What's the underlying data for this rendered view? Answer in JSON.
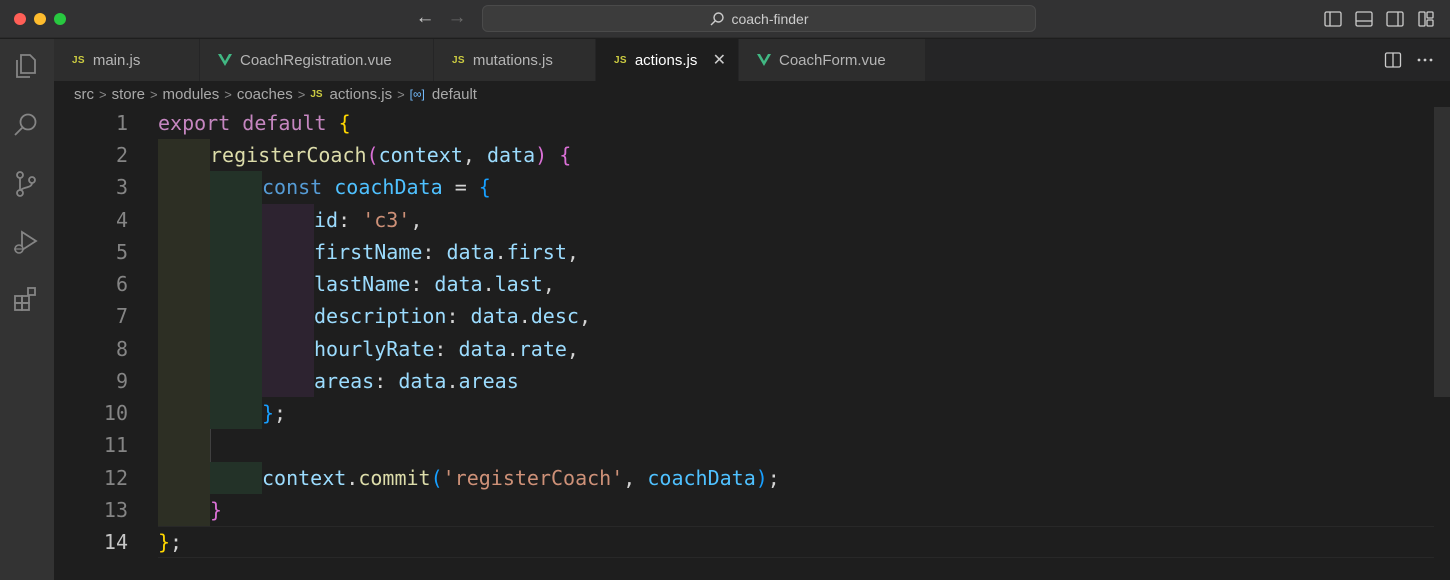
{
  "window": {
    "search_text": "coach-finder"
  },
  "tabs": [
    {
      "label": "main.js",
      "type": "js"
    },
    {
      "label": "CoachRegistration.vue",
      "type": "vue"
    },
    {
      "label": "mutations.js",
      "type": "js"
    },
    {
      "label": "actions.js",
      "type": "js",
      "active": true
    },
    {
      "label": "CoachForm.vue",
      "type": "vue"
    }
  ],
  "file_badge": "JS",
  "breadcrumb": {
    "parts": [
      "src",
      "store",
      "modules",
      "coaches"
    ],
    "file": "actions.js",
    "symbol": "default",
    "separator": ">"
  },
  "editor": {
    "line_numbers": [
      "1",
      "2",
      "3",
      "4",
      "5",
      "6",
      "7",
      "8",
      "9",
      "10",
      "11",
      "12",
      "13",
      "14"
    ],
    "current_line": "14",
    "lines": {
      "l1": {
        "export": "export",
        "default": "default",
        "brace": "{"
      },
      "l2": {
        "name": "registerCoach",
        "open": "(",
        "p1": "context",
        "comma": ",",
        "p2": "data",
        "close": ")",
        "brace": "{"
      },
      "l3": {
        "const": "const",
        "name": "coachData",
        "eq": "=",
        "brace": "{"
      },
      "l4": {
        "key": "id",
        "colon": ":",
        "val": "'c3'",
        "comma": ","
      },
      "l5": {
        "key": "firstName",
        "colon": ":",
        "obj": "data",
        "dot": ".",
        "prop": "first",
        "comma": ","
      },
      "l6": {
        "key": "lastName",
        "colon": ":",
        "obj": "data",
        "dot": ".",
        "prop": "last",
        "comma": ","
      },
      "l7": {
        "key": "description",
        "colon": ":",
        "obj": "data",
        "dot": ".",
        "prop": "desc",
        "comma": ","
      },
      "l8": {
        "key": "hourlyRate",
        "colon": ":",
        "obj": "data",
        "dot": ".",
        "prop": "rate",
        "comma": ","
      },
      "l9": {
        "key": "areas",
        "colon": ":",
        "obj": "data",
        "dot": ".",
        "prop": "areas"
      },
      "l10": {
        "brace": "}",
        "semi": ";"
      },
      "l12": {
        "obj": "context",
        "dot": ".",
        "method": "commit",
        "open": "(",
        "str": "'registerCoach'",
        "comma": ",",
        "arg": "coachData",
        "close": ")",
        "semi": ";"
      },
      "l13": {
        "brace": "}"
      },
      "l14": {
        "brace": "}",
        "semi": ";"
      }
    }
  },
  "icons": {
    "explorer": "files-icon",
    "search": "search-icon",
    "scm": "source-control-icon",
    "debug": "run-debug-icon",
    "extensions": "extensions-icon"
  },
  "colors": {
    "keyword": "#c586c0",
    "function": "#dcdcaa",
    "variable": "#9cdcfe",
    "string": "#ce9178",
    "js_badge": "#cbcb41",
    "vue": "#41b883"
  }
}
